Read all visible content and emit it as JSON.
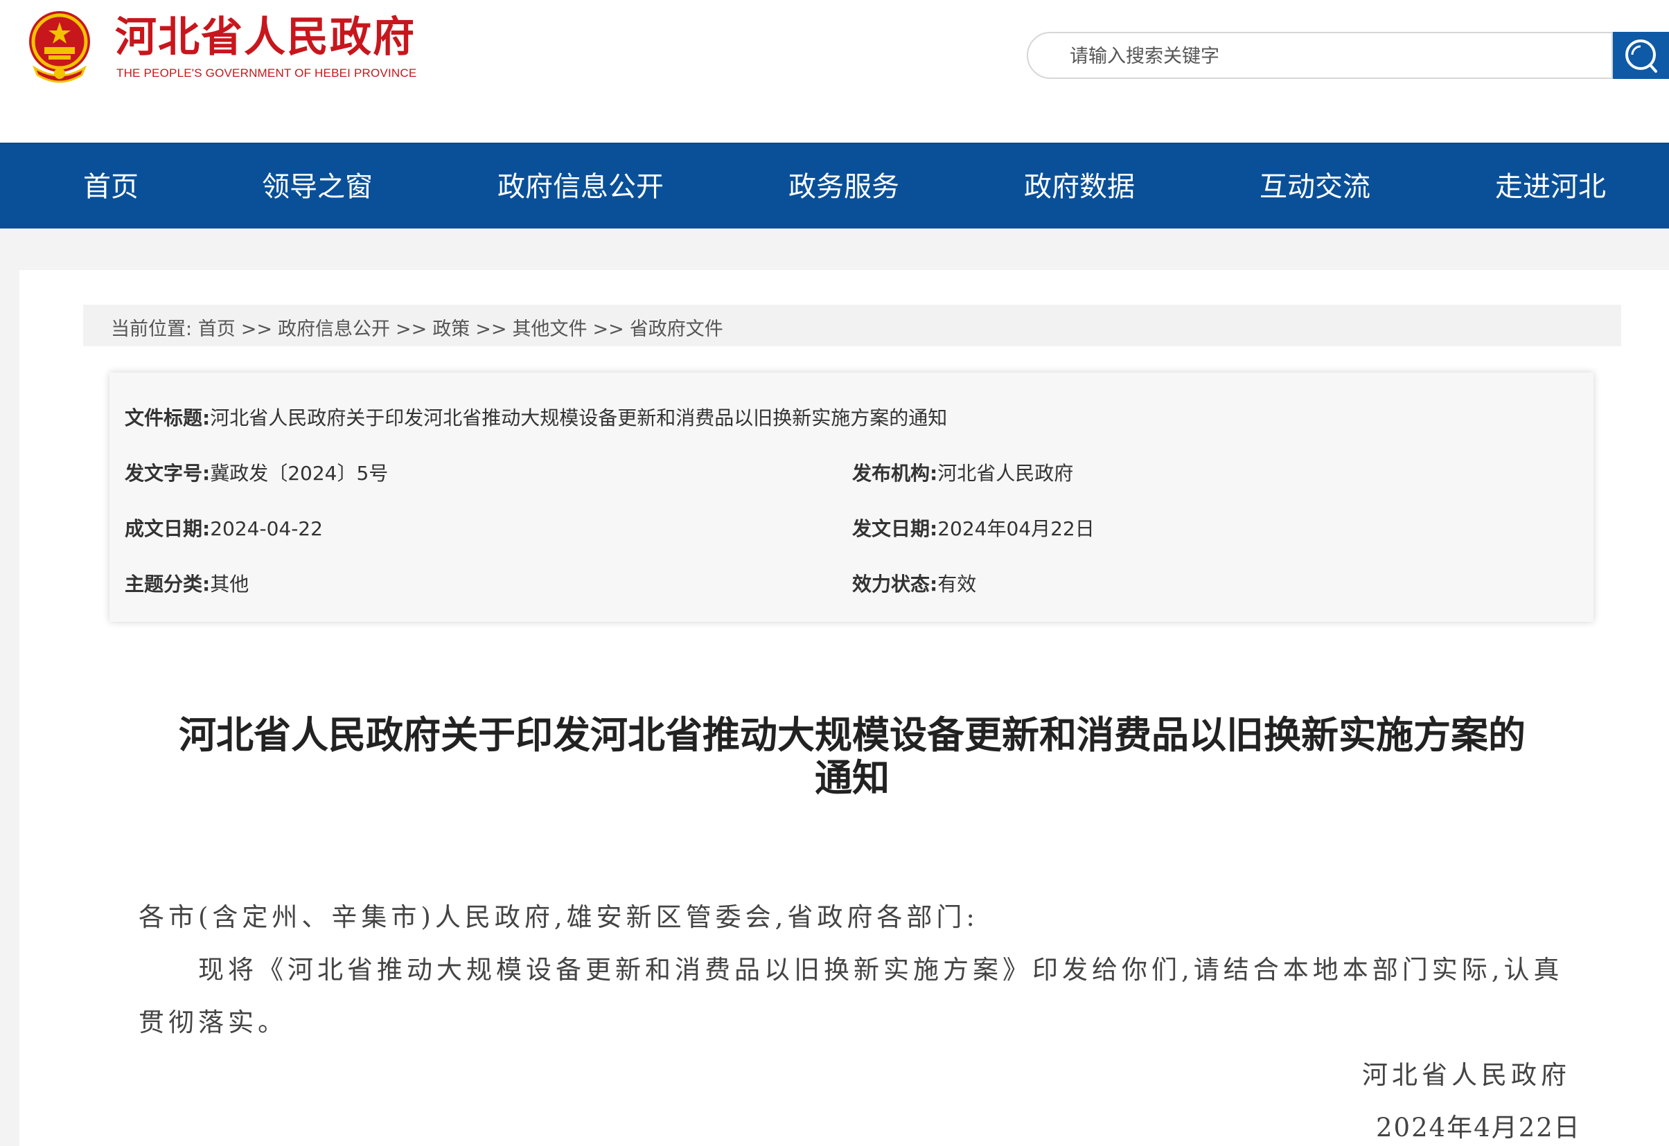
{
  "header": {
    "logo_cn": "河北省人民政府",
    "logo_en": "THE PEOPLE'S GOVERNMENT OF HEBEI PROVINCE",
    "search_placeholder": "请输入搜索关键字",
    "brand_red": "#c8161d",
    "brand_blue": "#0a5099"
  },
  "nav": {
    "items": [
      "首页",
      "领导之窗",
      "政府信息公开",
      "政务服务",
      "政府数据",
      "互动交流",
      "走进河北"
    ]
  },
  "breadcrumb": {
    "label": "当前位置:",
    "items": [
      "首页",
      "政府信息公开",
      "政策",
      "其他文件",
      "省政府文件"
    ],
    "separator": ">>"
  },
  "info": {
    "title_key": "文件标题:",
    "title_val": "河北省人民政府关于印发河北省推动大规模设备更新和消费品以旧换新实施方案的通知",
    "docno_key": "发文字号:",
    "docno_val": "冀政发〔2024〕5号",
    "issuer_key": "发布机构:",
    "issuer_val": "河北省人民政府",
    "written_key": "成文日期:",
    "written_val": "2024-04-22",
    "publish_key": "发文日期:",
    "publish_val": "2024年04月22日",
    "topic_key": "主题分类:",
    "topic_val": "其他",
    "status_key": "效力状态:",
    "status_val": "有效"
  },
  "document": {
    "title_line1": "河北省人民政府关于印发河北省推动大规模设备更新和消费品以旧换新实施方案的",
    "title_line2": "通知",
    "salutation": "各市(含定州、辛集市)人民政府,雄安新区管委会,省政府各部门:",
    "para_line1": "现将《河北省推动大规模设备更新和消费品以旧换新实施方案》印发给你们,请结合本地本部门实际,认真",
    "para_line2": "贯彻落实。",
    "signature": "河北省人民政府",
    "date": "2024年4月22日"
  }
}
